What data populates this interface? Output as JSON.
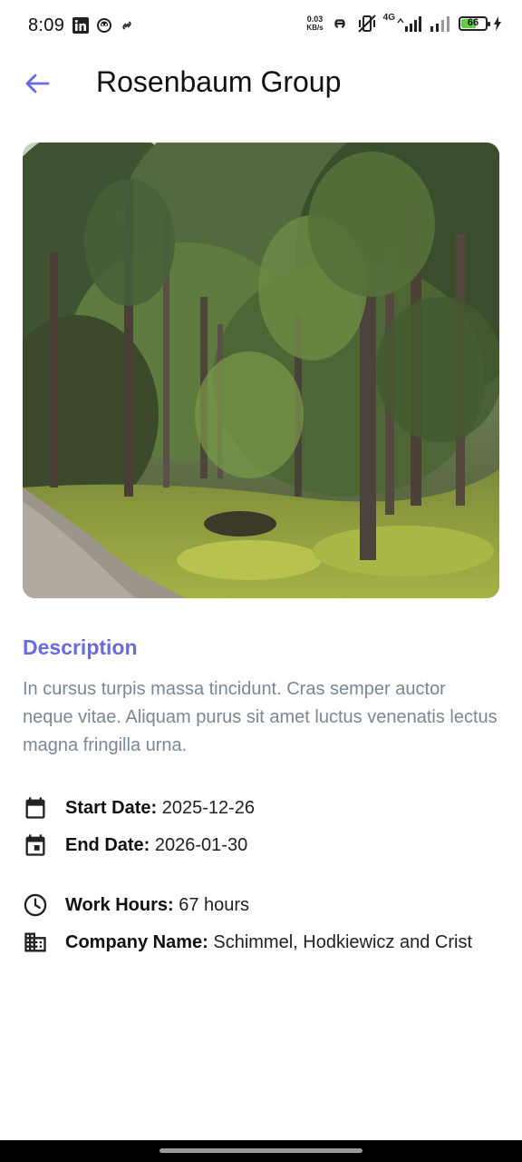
{
  "status_bar": {
    "time": "8:09",
    "speed_value": "0.03",
    "speed_unit": "KB/s",
    "network": "4G",
    "battery": "66",
    "battery_level": 0.66,
    "left_icons": [
      "linkedin-icon",
      "ghost-icon",
      "link-icon"
    ],
    "right_icons": [
      "hotspot-icon",
      "vibrate-off-icon",
      "signal-icon",
      "signal-icon",
      "charging-icon"
    ]
  },
  "header": {
    "title": "Rosenbaum Group",
    "back_icon": "arrow-left-icon",
    "accent_color": "#6a6be0"
  },
  "description": {
    "heading": "Description",
    "text": "In cursus turpis massa tincidunt. Cras semper auctor neque vitae. Aliquam purus sit amet luctus venenatis lectus magna fringilla urna."
  },
  "details": {
    "start_label": "Start Date:",
    "start_value": " 2025-12-26",
    "end_label": "End Date:",
    "end_value": " 2026-01-30",
    "hours_label": "Work Hours:",
    "hours_value": " 67 hours",
    "company_label": "Company Name:",
    "company_value": " Schimmel, Hodkiewicz and Crist",
    "icons": [
      "calendar-icon",
      "event-icon",
      "clock-icon",
      "building-icon"
    ]
  }
}
